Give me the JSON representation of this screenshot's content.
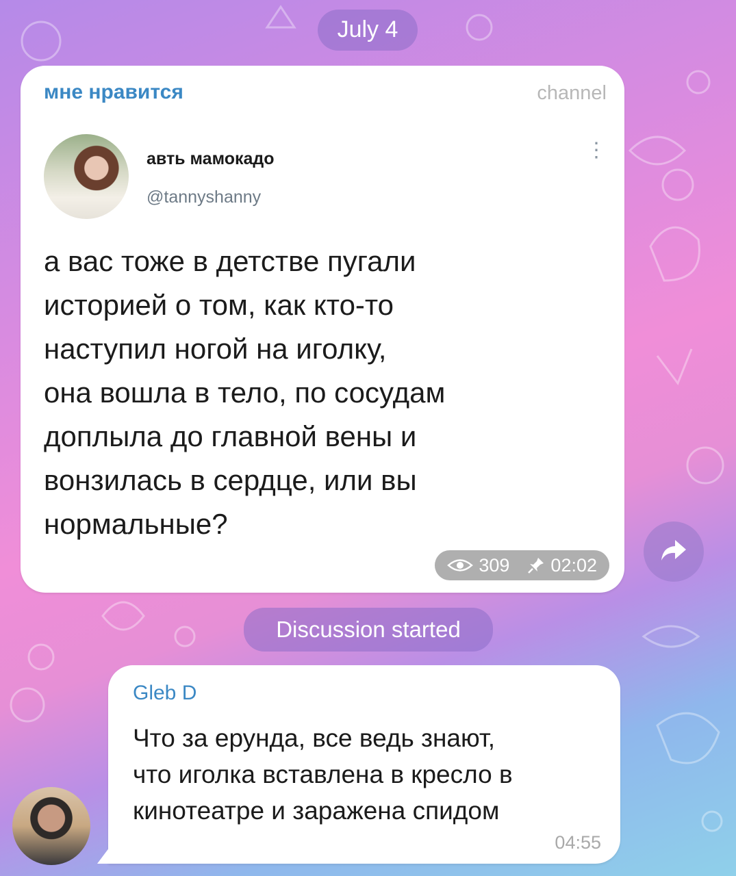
{
  "date_separator": "July 4",
  "post": {
    "channel_name": "мне нравится",
    "channel_tag": "channel",
    "tweet": {
      "author_name": "авть мамокадо",
      "author_handle": "@tannyshanny",
      "text": "а вас тоже в детстве пугали\nисторией о том, как кто-то\nнаступил ногой на иголку,\nона вошла в тело, по сосудам\nдоплыла до главной вены и\nвонзилась в сердце, или вы\nнормальные?"
    },
    "views": "309",
    "time": "02:02",
    "icons": {
      "views": "eye-icon",
      "pinned": "pin-icon",
      "share": "share-arrow-icon",
      "menu": "vertical-dots-icon"
    }
  },
  "service_message": "Discussion started",
  "reply": {
    "author": "Gleb D",
    "text": "Что за ерунда, все ведь знают,\nчто иголка вставлена в кресло в\nкинотеатре и заражена спидом",
    "time": "04:55"
  },
  "colors": {
    "accent": "#3b88c4"
  }
}
